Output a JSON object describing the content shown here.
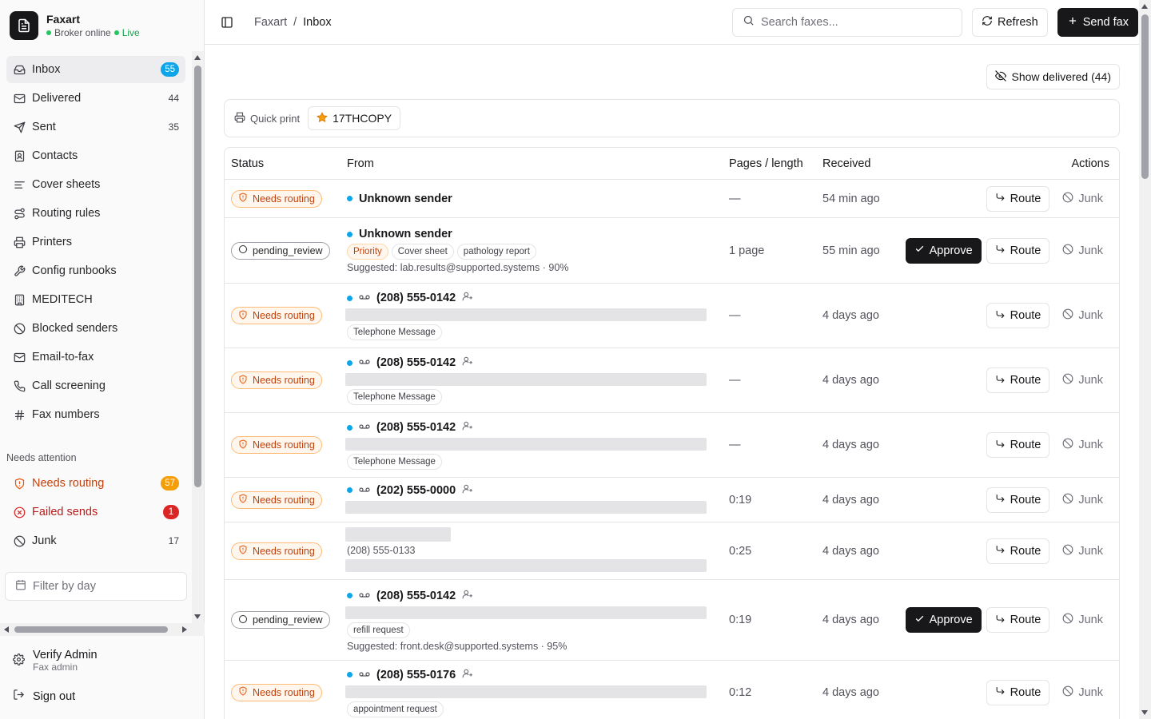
{
  "brand": {
    "name": "Faxart",
    "status": "Broker online",
    "live": "Live"
  },
  "nav": [
    {
      "label": "Inbox",
      "count": "55",
      "badge": "blue",
      "icon": "inbox-icon"
    },
    {
      "label": "Delivered",
      "count": "44",
      "icon": "mail-icon"
    },
    {
      "label": "Sent",
      "count": "35",
      "icon": "send-icon"
    },
    {
      "label": "Contacts",
      "icon": "contact-book-icon"
    },
    {
      "label": "Cover sheets",
      "icon": "cover-sheet-icon"
    },
    {
      "label": "Routing rules",
      "icon": "route-icon"
    },
    {
      "label": "Printers",
      "icon": "printer-icon"
    },
    {
      "label": "Config runbooks",
      "icon": "wrench-icon"
    },
    {
      "label": "MEDITECH",
      "icon": "hospital-icon"
    },
    {
      "label": "Blocked senders",
      "icon": "ban-icon"
    },
    {
      "label": "Email-to-fax",
      "icon": "mail-icon"
    },
    {
      "label": "Call screening",
      "icon": "phone-icon"
    },
    {
      "label": "Fax numbers",
      "icon": "hash-icon"
    }
  ],
  "attention": {
    "label": "Needs attention",
    "items": [
      {
        "label": "Needs routing",
        "count": "57"
      },
      {
        "label": "Failed sends",
        "count": "1"
      },
      {
        "label": "Junk",
        "count": "17"
      }
    ]
  },
  "filter_placeholder": "Filter by day",
  "user": {
    "name": "Verify Admin",
    "role": "Fax admin",
    "signout": "Sign out"
  },
  "breadcrumb": {
    "root": "Faxart",
    "sep": "/",
    "current": "Inbox"
  },
  "search_placeholder": "Search faxes...",
  "toolbar": {
    "refresh": "Refresh",
    "send": "Send fax",
    "show_delivered": "Show delivered (44)"
  },
  "quick_print": {
    "label": "Quick print",
    "printer": "17THCOPY"
  },
  "table": {
    "headers": {
      "status": "Status",
      "from": "From",
      "pages": "Pages / length",
      "received": "Received",
      "actions": "Actions"
    },
    "labels": {
      "approve": "Approve",
      "route": "Route",
      "junk": "Junk"
    },
    "rows": [
      {
        "status": "Needs routing",
        "kind": "routing",
        "from": "Unknown sender",
        "pages": "—",
        "received": "54 min ago"
      },
      {
        "status": "pending_review",
        "kind": "pending",
        "from": "Unknown sender",
        "tags": [
          "Priority",
          "Cover sheet",
          "pathology report"
        ],
        "suggested": "Suggested: lab.results@supported.systems · 90%",
        "pages": "1 page",
        "received": "55 min ago"
      },
      {
        "status": "Needs routing",
        "kind": "routing",
        "voicemail": true,
        "from": "(208) 555-0142",
        "tags": [
          "Telephone Message"
        ],
        "pages": "—",
        "received": "4 days ago"
      },
      {
        "status": "Needs routing",
        "kind": "routing",
        "voicemail": true,
        "from": "(208) 555-0142",
        "tags": [
          "Telephone Message"
        ],
        "pages": "—",
        "received": "4 days ago"
      },
      {
        "status": "Needs routing",
        "kind": "routing",
        "voicemail": true,
        "from": "(208) 555-0142",
        "tags": [
          "Telephone Message"
        ],
        "pages": "—",
        "received": "4 days ago"
      },
      {
        "status": "Needs routing",
        "kind": "routing",
        "voicemail": true,
        "from": "(202) 555-0000",
        "pages": "0:19",
        "received": "4 days ago"
      },
      {
        "status": "Needs routing",
        "kind": "routing",
        "number_sub": "(208) 555-0133",
        "pages": "0:25",
        "received": "4 days ago"
      },
      {
        "status": "pending_review",
        "kind": "pending",
        "voicemail": true,
        "from": "(208) 555-0142",
        "tags": [
          "refill request"
        ],
        "suggested": "Suggested: front.desk@supported.systems · 95%",
        "pages": "0:19",
        "received": "4 days ago"
      },
      {
        "status": "Needs routing",
        "kind": "routing",
        "voicemail": true,
        "from": "(208) 555-0176",
        "tags": [
          "appointment request"
        ],
        "pages": "0:12",
        "received": "4 days ago"
      }
    ]
  }
}
